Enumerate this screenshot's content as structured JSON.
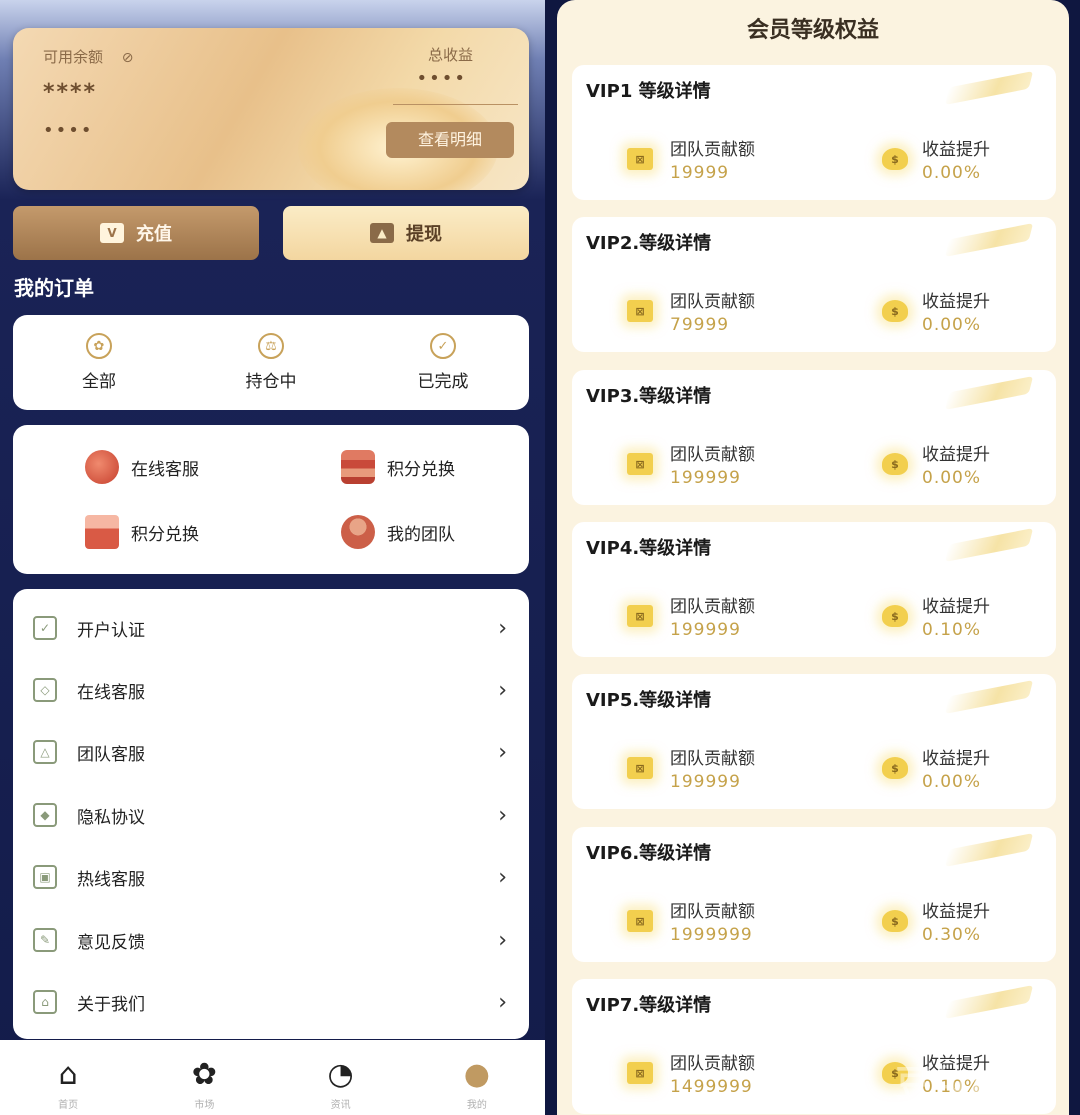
{
  "balance": {
    "available_label": "可用余额",
    "eye_icon": "eye-off-icon",
    "available_masked": "****",
    "frozen_masked": "••••",
    "income_label": "总收益",
    "income_masked": "••••",
    "detail_button": "查看明细"
  },
  "actions": {
    "recharge": "充值",
    "withdraw": "提现"
  },
  "orders": {
    "title": "我的订单",
    "items": [
      {
        "label": "全部",
        "icon": "grid-icon"
      },
      {
        "label": "持仓中",
        "icon": "scale-icon"
      },
      {
        "label": "已完成",
        "icon": "badge-check-icon"
      }
    ]
  },
  "quick": [
    {
      "label": "在线客服",
      "icon": "headset-icon"
    },
    {
      "label": "积分兑换",
      "icon": "coins-stack-icon"
    },
    {
      "label": "积分兑换",
      "icon": "envelope-icon"
    },
    {
      "label": "我的团队",
      "icon": "team-icon"
    }
  ],
  "menu": [
    {
      "label": "开户认证",
      "icon": "verify-icon"
    },
    {
      "label": "在线客服",
      "icon": "diamond-icon"
    },
    {
      "label": "团队客服",
      "icon": "team-service-icon"
    },
    {
      "label": "隐私协议",
      "icon": "shield-icon"
    },
    {
      "label": "热线客服",
      "icon": "lock-icon"
    },
    {
      "label": "意见反馈",
      "icon": "edit-icon"
    },
    {
      "label": "关于我们",
      "icon": "home-info-icon"
    }
  ],
  "tabs": [
    {
      "label": "首页",
      "icon": "home-icon"
    },
    {
      "label": "市场",
      "icon": "grid-icon"
    },
    {
      "label": "资讯",
      "icon": "pie-chart-icon"
    },
    {
      "label": "我的",
      "icon": "user-icon"
    }
  ],
  "vip": {
    "title": "会员等级权益",
    "contribution_label": "团队贡献额",
    "yield_label": "收益提升",
    "levels": [
      {
        "title": "VIP1 等级详情",
        "contribution": "19999",
        "yield": "0.00%"
      },
      {
        "title": "VIP2.等级详情",
        "contribution": "79999",
        "yield": "0.00%"
      },
      {
        "title": "VIP3.等级详情",
        "contribution": "199999",
        "yield": "0.00%"
      },
      {
        "title": "VIP4.等级详情",
        "contribution": "199999",
        "yield": "0.10%"
      },
      {
        "title": "VIP5.等级详情",
        "contribution": "199999",
        "yield": "0.00%"
      },
      {
        "title": "VIP6.等级详情",
        "contribution": "1999999",
        "yield": "0.30%"
      },
      {
        "title": "VIP7.等级详情",
        "contribution": "1499999",
        "yield": "0.10%"
      }
    ]
  },
  "watermark": "豆包AI生成"
}
